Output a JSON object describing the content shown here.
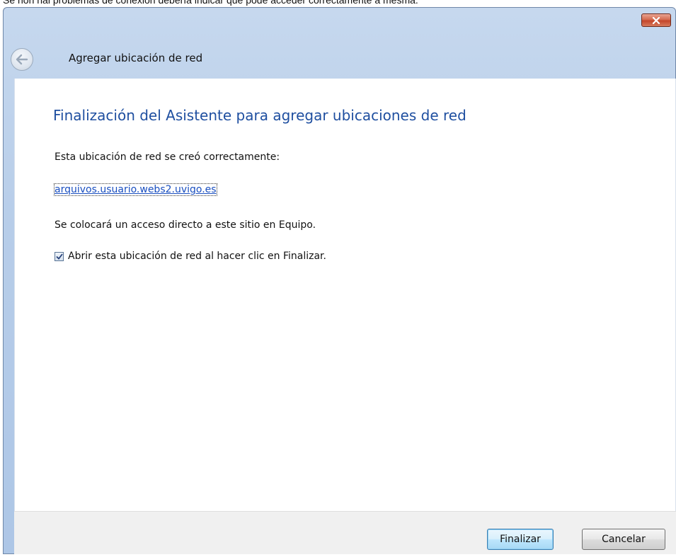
{
  "caption": "Se non hai problemas de conexión debería indicar que pode acceder correctamente á mesma.",
  "window": {
    "title": "Agregar ubicación de red",
    "close_icon": "close-icon",
    "back_icon": "back-arrow-icon"
  },
  "wizard": {
    "heading": "Finalización del Asistente para agregar ubicaciones de red",
    "success_text": "Esta ubicación de red se creó correctamente:",
    "location_link": "arquivos.usuario.webs2.uvigo.es",
    "shortcut_text": "Se colocará un acceso directo a este sitio en Equipo.",
    "open_checkbox": {
      "label": "Abrir esta ubicación de red al hacer clic en Finalizar.",
      "checked": true
    }
  },
  "footer": {
    "finish_label": "Finalizar",
    "cancel_label": "Cancelar"
  },
  "colors": {
    "heading": "#1f4fa0",
    "link": "#1a4fc0",
    "close_button": "#c4452a"
  }
}
